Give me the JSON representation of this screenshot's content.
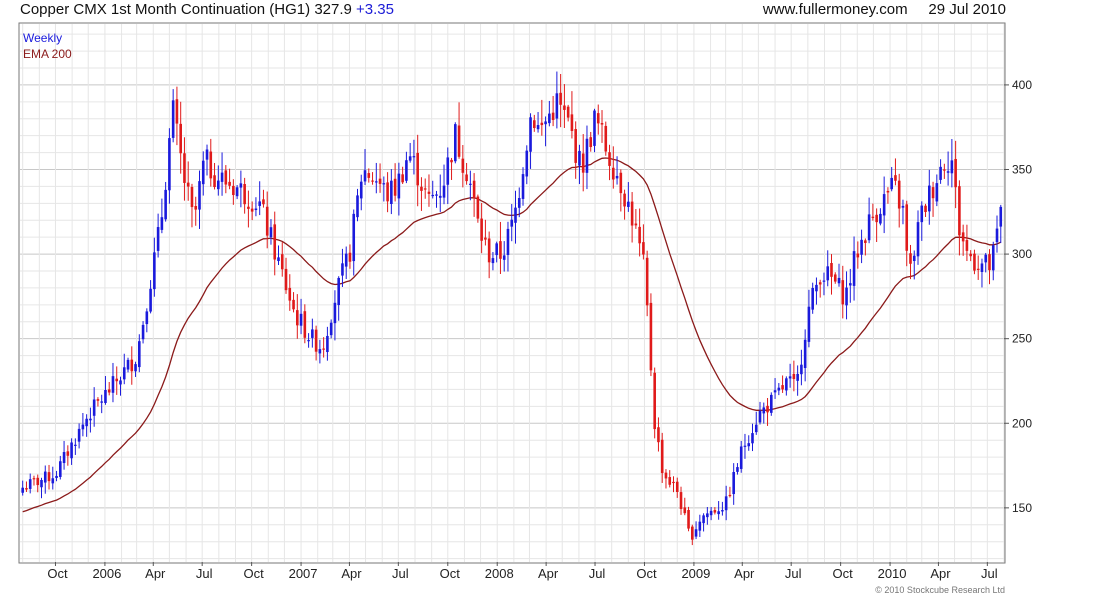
{
  "header": {
    "title": "Copper CMX 1st Month Continuation (HG1)",
    "last": "327.9",
    "change": "+3.35",
    "site": "www.fullermoney.com",
    "date": "29 Jul 2010"
  },
  "credit": "© 2010 Stockcube Research Ltd",
  "colors": {
    "up": "#1a1adc",
    "down": "#e01a1a",
    "ema": "#8b1a1a",
    "grid": "#dcdcdc"
  },
  "chart_data": {
    "type": "candlestick",
    "interval_label": "Weekly",
    "indicator_label": "EMA 200",
    "y_ticks": [
      150,
      200,
      250,
      300,
      350,
      400
    ],
    "ylim": [
      118,
      436
    ],
    "x_ticks": [
      "Oct",
      "2006",
      "Apr",
      "Jul",
      "Oct",
      "2007",
      "Apr",
      "Jul",
      "Oct",
      "2008",
      "Apr",
      "Jul",
      "Oct",
      "2009",
      "Apr",
      "Jul",
      "Oct",
      "2010",
      "Apr",
      "Jul"
    ],
    "close_anchors": [
      [
        "2005-08-01",
        162
      ],
      [
        "2005-10-01",
        170
      ],
      [
        "2005-12-01",
        205
      ],
      [
        "2006-01-15",
        222
      ],
      [
        "2006-03-01",
        240
      ],
      [
        "2006-04-15",
        318
      ],
      [
        "2006-05-07",
        385
      ],
      [
        "2006-05-28",
        345
      ],
      [
        "2006-06-15",
        318
      ],
      [
        "2006-07-05",
        355
      ],
      [
        "2006-08-01",
        345
      ],
      [
        "2006-09-01",
        340
      ],
      [
        "2006-10-15",
        330
      ],
      [
        "2006-11-15",
        300
      ],
      [
        "2006-12-20",
        265
      ],
      [
        "2007-01-20",
        250
      ],
      [
        "2007-02-10",
        245
      ],
      [
        "2007-03-01",
        270
      ],
      [
        "2007-04-01",
        300
      ],
      [
        "2007-04-25",
        350
      ],
      [
        "2007-05-20",
        345
      ],
      [
        "2007-06-10",
        335
      ],
      [
        "2007-06-28",
        340
      ],
      [
        "2007-07-20",
        360
      ],
      [
        "2007-08-10",
        345
      ],
      [
        "2007-08-25",
        330
      ],
      [
        "2007-09-20",
        340
      ],
      [
        "2007-10-15",
        370
      ],
      [
        "2007-11-10",
        345
      ],
      [
        "2007-11-28",
        315
      ],
      [
        "2007-12-15",
        300
      ],
      [
        "2008-01-10",
        300
      ],
      [
        "2008-02-01",
        320
      ],
      [
        "2008-03-05",
        385
      ],
      [
        "2008-03-20",
        372
      ],
      [
        "2008-04-20",
        390
      ],
      [
        "2008-05-15",
        375
      ],
      [
        "2008-06-05",
        350
      ],
      [
        "2008-07-01",
        380
      ],
      [
        "2008-07-25",
        360
      ],
      [
        "2008-08-15",
        345
      ],
      [
        "2008-09-10",
        320
      ],
      [
        "2008-10-01",
        290
      ],
      [
        "2008-10-20",
        200
      ],
      [
        "2008-11-05",
        170
      ],
      [
        "2008-12-01",
        160
      ],
      [
        "2008-12-25",
        132
      ],
      [
        "2009-01-15",
        145
      ],
      [
        "2009-02-15",
        150
      ],
      [
        "2009-03-01",
        152
      ],
      [
        "2009-04-01",
        185
      ],
      [
        "2009-05-01",
        205
      ],
      [
        "2009-06-01",
        215
      ],
      [
        "2009-06-25",
        225
      ],
      [
        "2009-07-10",
        220
      ],
      [
        "2009-08-01",
        265
      ],
      [
        "2009-08-25",
        290
      ],
      [
        "2009-09-15",
        285
      ],
      [
        "2009-10-10",
        275
      ],
      [
        "2009-10-30",
        300
      ],
      [
        "2009-11-25",
        320
      ],
      [
        "2009-12-15",
        330
      ],
      [
        "2010-01-08",
        340
      ],
      [
        "2010-01-25",
        325
      ],
      [
        "2010-02-05",
        285
      ],
      [
        "2010-02-25",
        320
      ],
      [
        "2010-03-15",
        335
      ],
      [
        "2010-04-10",
        355
      ],
      [
        "2010-04-25",
        358
      ],
      [
        "2010-05-10",
        315
      ],
      [
        "2010-05-25",
        300
      ],
      [
        "2010-06-15",
        295
      ],
      [
        "2010-07-08",
        292
      ],
      [
        "2010-07-29",
        327.9
      ]
    ]
  }
}
